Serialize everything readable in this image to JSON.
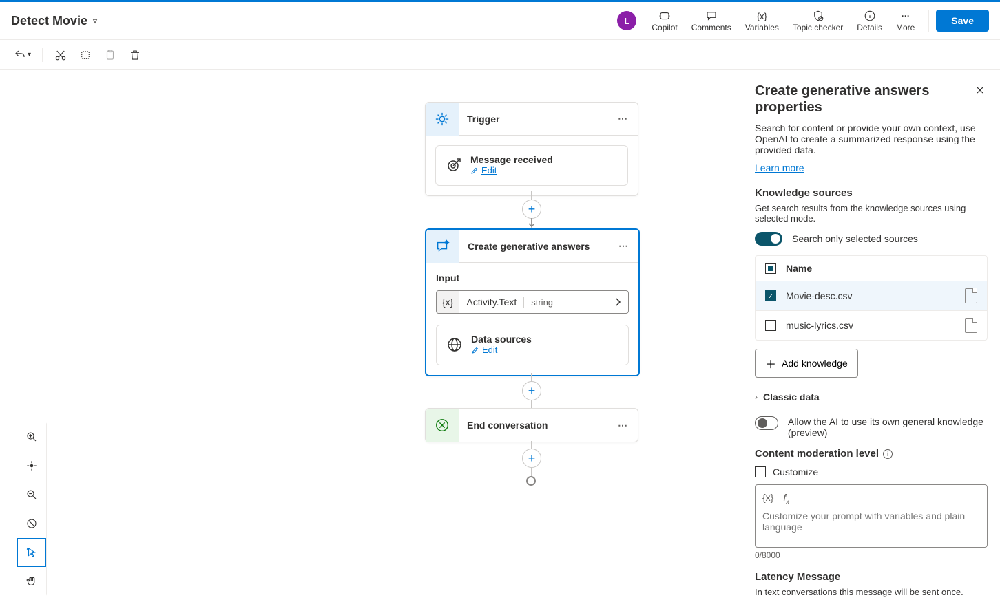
{
  "header": {
    "title": "Detect Movie",
    "avatar_initial": "L",
    "actions": {
      "copilot": "Copilot",
      "comments": "Comments",
      "variables": "Variables",
      "topic_checker": "Topic checker",
      "details": "Details",
      "more": "More"
    },
    "save": "Save"
  },
  "canvas": {
    "trigger": {
      "title": "Trigger",
      "sub_label": "Message received",
      "edit": "Edit"
    },
    "gen": {
      "title": "Create generative answers",
      "input_label": "Input",
      "var_symbol": "{x}",
      "var_name": "Activity.Text",
      "var_type": "string",
      "data_sources_label": "Data sources",
      "edit": "Edit"
    },
    "end": {
      "title": "End conversation"
    }
  },
  "panel": {
    "title": "Create generative answers properties",
    "desc": "Search for content or provide your own context, use OpenAI to create a summarized response using the provided data.",
    "learn_more": "Learn more",
    "knowledge_heading": "Knowledge sources",
    "knowledge_desc": "Get search results from the knowledge sources using selected mode.",
    "search_toggle_label": "Search only selected sources",
    "name_col": "Name",
    "sources": [
      {
        "name": "Movie-desc.csv",
        "checked": true
      },
      {
        "name": "music-lyrics.csv",
        "checked": false
      }
    ],
    "add_knowledge": "Add knowledge",
    "classic_data": "Classic data",
    "allow_ai_label": "Allow the AI to use its own general knowledge (preview)",
    "moderation_heading": "Content moderation level",
    "customize_label": "Customize",
    "prompt_placeholder": "Customize your prompt with variables and plain language",
    "counter": "0/8000",
    "latency_heading": "Latency Message",
    "latency_desc": "In text conversations this message will be sent once."
  }
}
